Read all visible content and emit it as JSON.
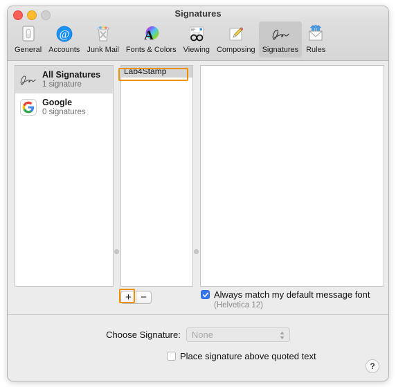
{
  "window": {
    "title": "Signatures",
    "traffic_lights": [
      "close",
      "minimize",
      "zoom"
    ]
  },
  "toolbar": {
    "items": [
      {
        "label": "General",
        "icon": "general-icon",
        "selected": false
      },
      {
        "label": "Accounts",
        "icon": "accounts-at-icon",
        "selected": false
      },
      {
        "label": "Junk Mail",
        "icon": "junk-mail-icon",
        "selected": false
      },
      {
        "label": "Fonts & Colors",
        "icon": "fonts-colors-icon",
        "selected": false
      },
      {
        "label": "Viewing",
        "icon": "viewing-glasses-icon",
        "selected": false
      },
      {
        "label": "Composing",
        "icon": "composing-pencil-icon",
        "selected": false
      },
      {
        "label": "Signatures",
        "icon": "signature-icon",
        "selected": true
      },
      {
        "label": "Rules",
        "icon": "rules-envelope-icon",
        "selected": false
      }
    ]
  },
  "accounts_pane": {
    "rows": [
      {
        "name": "All Signatures",
        "subtitle": "1 signature",
        "icon": "signature-icon",
        "selected": true
      },
      {
        "name": "Google",
        "subtitle": "0 signatures",
        "icon": "google-g-icon",
        "selected": false
      }
    ]
  },
  "signature_list": {
    "rows": [
      {
        "name": "Lab4Stamp",
        "selected": true
      }
    ]
  },
  "preview_pane": {
    "content": ""
  },
  "add_remove": {
    "add_label": "+",
    "remove_label": "−"
  },
  "font_match": {
    "checked": true,
    "label": "Always match my default message font",
    "sublabel": "(Helvetica 12)"
  },
  "bottom": {
    "choose_signature_label": "Choose Signature:",
    "choose_signature_value": "None",
    "place_above_checked": false,
    "place_above_label": "Place signature above quoted text",
    "help_label": "?"
  },
  "colors": {
    "annotation": "#f29100",
    "checkbox_on": "#3478f6",
    "window_bg": "#ececec",
    "selected_row": "#dcdcdc"
  }
}
